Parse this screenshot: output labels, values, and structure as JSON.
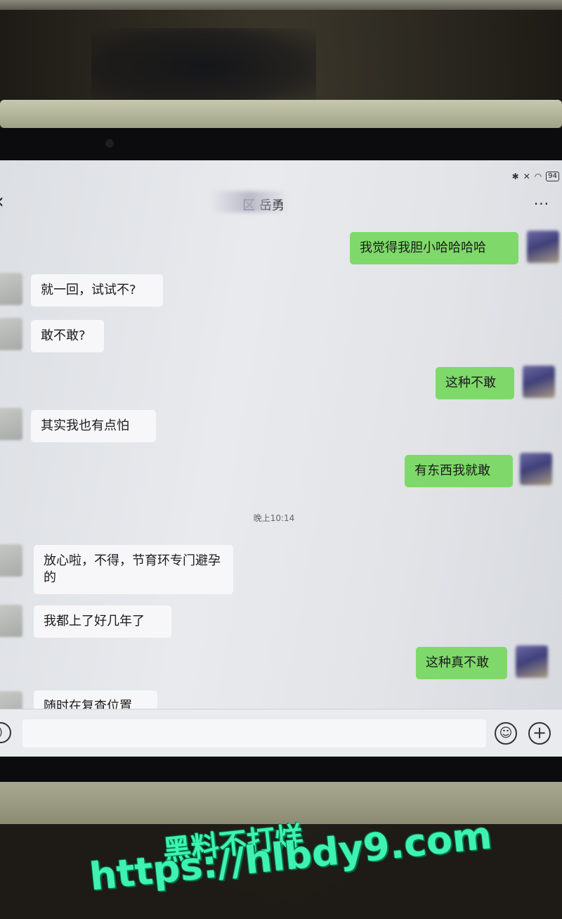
{
  "status_bar": {
    "battery": "94"
  },
  "header": {
    "title": "区 岳勇",
    "more": "···"
  },
  "messages": [
    {
      "side": "out",
      "text": "我觉得我胆小哈哈哈哈"
    },
    {
      "side": "in",
      "text": "就一回，试试不?"
    },
    {
      "side": "in",
      "text": "敢不敢?"
    },
    {
      "side": "out",
      "text": "这种不敢"
    },
    {
      "side": "in",
      "text": "其实我也有点怕"
    },
    {
      "side": "out",
      "text": "有东西我就敢"
    },
    {
      "side": "in",
      "text": "放心啦，不得，节育环专门避孕的"
    },
    {
      "side": "in",
      "text": "我都上了好几年了"
    },
    {
      "side": "out",
      "text": "这种真不敢"
    },
    {
      "side": "in",
      "text": "随时在复查位置"
    }
  ],
  "timestamp": "晚上10:14",
  "watermark": {
    "line1": "黑料不打烊",
    "line2": "https://hlbdy9.com"
  },
  "colors": {
    "out_bubble": "#7ed96a",
    "in_bubble": "#f7f7f9",
    "watermark": "#3ff2b4"
  }
}
